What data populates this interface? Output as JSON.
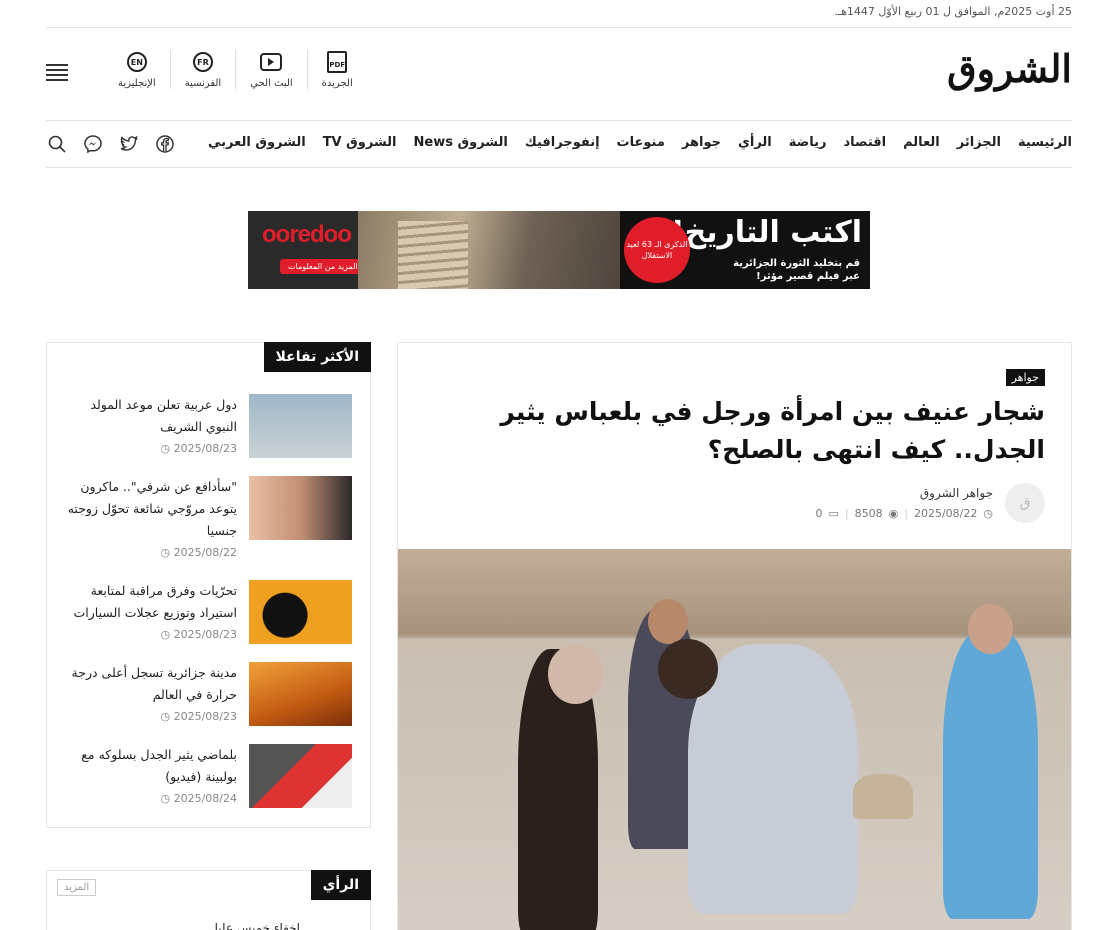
{
  "date": "25 أوت 2025م, الموافق ل 01 ربيع الأوّل 1447هـ.",
  "logo": "الشروق",
  "tools": [
    {
      "label": "الإنجليزية",
      "icon_text": "EN",
      "icon": "english-icon"
    },
    {
      "label": "الفرنسية",
      "icon_text": "FR",
      "icon": "french-icon"
    },
    {
      "label": "البث الحي",
      "icon": "play-icon"
    },
    {
      "label": "الجريدة",
      "icon_text": "PDF",
      "icon": "pdf-icon"
    }
  ],
  "nav": [
    "الرئيسية",
    "الجزائر",
    "العالم",
    "اقتصاد",
    "رياضة",
    "الرأي",
    "جواهر",
    "منوعات",
    "إنفوجرافيك",
    "الشروق News",
    "الشروق TV",
    "الشروق العربي"
  ],
  "ad": {
    "headline": "اكتب التاريخ!",
    "sub1": "قم بتخليد الثورة الجزائرية",
    "sub2": "عبر فيلم قصير مؤثر!",
    "badge": "الذكرى الـ 63 لعيد الاستقلال",
    "brand": "ooredoo",
    "more": "المزيد من المعلومات"
  },
  "article": {
    "category": "جواهر",
    "title": "شجار عنيف بين امرأة ورجل في بلعباس يثير الجدل.. كيف انتهى بالصلح؟",
    "author": "جواهر الشروق",
    "date": "2025/08/22",
    "views": "8508",
    "comments": "0"
  },
  "sidebar": {
    "heading": "الأكثر تفاعلا",
    "items": [
      {
        "title": "دول عربية تعلن موعد المولد النبوي الشريف",
        "date": "2025/08/23"
      },
      {
        "title": "\"سأدافع عن شرفي\".. ماكرون يتوعد مروّجي شائعة تحوّل زوجته جنسيا",
        "date": "2025/08/22"
      },
      {
        "title": "تحرّيات وفرق مراقبة لمتابعة استيراد وتوزيع عجلات السيارات",
        "date": "2025/08/23"
      },
      {
        "title": "مدينة جزائرية تسجل أعلى درجة حرارة في العالم",
        "date": "2025/08/23"
      },
      {
        "title": "بلماضي يثير الجدل بسلوكه مع بولبينة (فيديو)",
        "date": "2025/08/24"
      }
    ]
  },
  "opinion": {
    "heading": "الرأي",
    "more": "المزيد",
    "snippet": "إخفاء خميس عليا"
  },
  "colors": {
    "accent": "#e11d2a",
    "dark": "#111111"
  }
}
